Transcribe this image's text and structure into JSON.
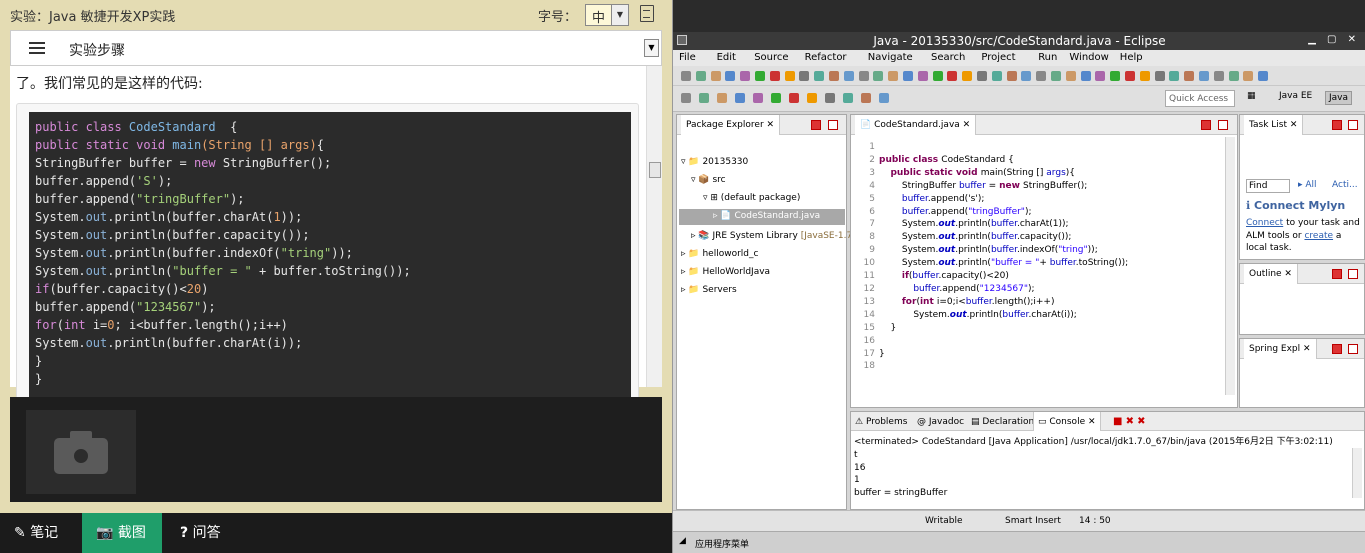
{
  "left": {
    "header_title": "实验：Java 敏捷开发XP实践",
    "font_label": "字号：",
    "font_value": "中",
    "steps_label": "实验步骤",
    "intro": "了。我们常见的是这样的代码:",
    "code_lines": [
      [
        [
          "kw",
          "public class "
        ],
        [
          "fn",
          "CodeStandard"
        ],
        [
          "",
          "  {"
        ]
      ],
      [
        [
          "kw",
          "public static void "
        ],
        [
          "fn",
          "main"
        ],
        [
          "nm",
          "(String [] args)"
        ],
        [
          "",
          "{"
        ]
      ],
      [
        [
          "",
          "StringBuffer buffer = "
        ],
        [
          "kw",
          "new "
        ],
        [
          "",
          "StringBuffer();"
        ]
      ],
      [
        [
          "",
          "buffer.append("
        ],
        [
          "st",
          "'S'"
        ],
        [
          "",
          ");"
        ]
      ],
      [
        [
          "",
          "buffer.append("
        ],
        [
          "st",
          "\"tringBuffer\""
        ],
        [
          "",
          ");"
        ]
      ],
      [
        [
          "",
          "System."
        ],
        [
          "ob",
          "out"
        ],
        [
          "",
          ".println(buffer.charAt("
        ],
        [
          "nm",
          "1"
        ],
        [
          "",
          "));"
        ]
      ],
      [
        [
          "",
          "System."
        ],
        [
          "ob",
          "out"
        ],
        [
          "",
          ".println(buffer.capacity());"
        ]
      ],
      [
        [
          "",
          "System."
        ],
        [
          "ob",
          "out"
        ],
        [
          "",
          ".println(buffer.indexOf("
        ],
        [
          "st",
          "\"tring\""
        ],
        [
          "",
          "));"
        ]
      ],
      [
        [
          "",
          "System."
        ],
        [
          "ob",
          "out"
        ],
        [
          "",
          ".println("
        ],
        [
          "st",
          "\"buffer = \""
        ],
        [
          "",
          " + buffer.toString());"
        ]
      ],
      [
        [
          "kw",
          "if"
        ],
        [
          "",
          "(buffer.capacity()<"
        ],
        [
          "nm",
          "20"
        ],
        [
          "",
          ")"
        ]
      ],
      [
        [
          "",
          "buffer.append("
        ],
        [
          "st",
          "\"1234567\""
        ],
        [
          "",
          ");"
        ]
      ],
      [
        [
          "kw",
          "for"
        ],
        [
          "",
          "("
        ],
        [
          "kw",
          "int "
        ],
        [
          "",
          "i="
        ],
        [
          "nm",
          "0"
        ],
        [
          "",
          "; i<buffer.length();i++)"
        ]
      ],
      [
        [
          "",
          "System."
        ],
        [
          "ob",
          "out"
        ],
        [
          "",
          ".println(buffer.charAt(i));"
        ]
      ],
      [
        [
          "",
          "}"
        ]
      ],
      [
        [
          "",
          "}"
        ]
      ]
    ],
    "bottom_tabs": [
      {
        "icon": "pencil-icon",
        "label": "笔记"
      },
      {
        "icon": "camera-icon",
        "label": "截图"
      },
      {
        "icon": "question-icon",
        "label": "问答"
      }
    ]
  },
  "eclipse": {
    "title": "Java - 20135330/src/CodeStandard.java - Eclipse",
    "menu": [
      "File",
      "Edit",
      "Source",
      "Refactor",
      "Navigate",
      "Search",
      "Project",
      "Run",
      "Window",
      "Help"
    ],
    "quick_access": "Quick Access",
    "perspectives": [
      "Java EE",
      "Java"
    ],
    "package_explorer": {
      "tab": "Package Explorer",
      "items": [
        "20135330",
        "src",
        "(default package)",
        "CodeStandard.java",
        "JRE System Library",
        "[JavaSE-1.7]",
        "helloworld_c",
        "HelloWorldJava",
        "Servers"
      ]
    },
    "editor": {
      "tab": "CodeStandard.java",
      "line_numbers": [
        "1",
        "2",
        "3",
        "4",
        "5",
        "6",
        "7",
        "8",
        "9",
        "10",
        "11",
        "12",
        "13",
        "14",
        "15",
        "16",
        "17",
        "18"
      ],
      "lines": [
        [],
        [
          [
            "ek",
            "public class "
          ],
          [
            "",
            "CodeStandard {"
          ]
        ],
        [
          [
            "",
            "    "
          ],
          [
            "ek",
            "public static void "
          ],
          [
            "",
            "main(String [] "
          ],
          [
            "ev",
            "args"
          ],
          [
            "",
            ")"
          ],
          [
            "",
            "{"
          ]
        ],
        [
          [
            "",
            "        StringBuffer "
          ],
          [
            "ev",
            "buffer"
          ],
          [
            "",
            " = "
          ],
          [
            "ek",
            "new "
          ],
          [
            "",
            "StringBuffer();"
          ]
        ],
        [
          [
            "",
            "        "
          ],
          [
            "ev",
            "buffer"
          ],
          [
            "",
            ".append('s');"
          ]
        ],
        [
          [
            "",
            "        "
          ],
          [
            "ev",
            "buffer"
          ],
          [
            "",
            ".append("
          ],
          [
            "es",
            "\"tringBuffer\""
          ],
          [
            "",
            ");"
          ]
        ],
        [
          [
            "",
            "        System."
          ],
          [
            "ei",
            "out"
          ],
          [
            "",
            ".println("
          ],
          [
            "ev",
            "buffer"
          ],
          [
            "",
            ".charAt(1));"
          ]
        ],
        [
          [
            "",
            "        System."
          ],
          [
            "ei",
            "out"
          ],
          [
            "",
            ".println("
          ],
          [
            "ev",
            "buffer"
          ],
          [
            "",
            ".capacity());"
          ]
        ],
        [
          [
            "",
            "        System."
          ],
          [
            "ei",
            "out"
          ],
          [
            "",
            ".println("
          ],
          [
            "ev",
            "buffer"
          ],
          [
            "",
            ".indexOf("
          ],
          [
            "es",
            "\"tring\""
          ],
          [
            "",
            "));"
          ]
        ],
        [
          [
            "",
            "        System."
          ],
          [
            "ei",
            "out"
          ],
          [
            "",
            ".println("
          ],
          [
            "es",
            "\"buffer = \""
          ],
          [
            "",
            "+ "
          ],
          [
            "ev",
            "buffer"
          ],
          [
            "",
            ".toString());"
          ]
        ],
        [
          [
            "",
            "        "
          ],
          [
            "ek",
            "if"
          ],
          [
            "",
            "("
          ],
          [
            "ev",
            "buffer"
          ],
          [
            "",
            ".capacity()<20)"
          ]
        ],
        [
          [
            "",
            "            "
          ],
          [
            "ev",
            "buffer"
          ],
          [
            "",
            ".append("
          ],
          [
            "es",
            "\"1234567\""
          ],
          [
            "",
            ");"
          ]
        ],
        [
          [
            "",
            "        "
          ],
          [
            "ek",
            "for"
          ],
          [
            "",
            "("
          ],
          [
            "ek",
            "int "
          ],
          [
            "",
            "i=0;i<"
          ],
          [
            "ev",
            "buffer"
          ],
          [
            "",
            ".length();i++)"
          ]
        ],
        [
          [
            "",
            "            System."
          ],
          [
            "ei",
            "out"
          ],
          [
            "",
            ".println("
          ],
          [
            "ev",
            "buffer"
          ],
          [
            "",
            ".charAt(i));"
          ]
        ],
        [
          [
            "",
            "    }"
          ]
        ],
        [],
        [
          [
            "",
            "}"
          ]
        ],
        []
      ]
    },
    "task_list": {
      "tab": "Task List",
      "find": "Find",
      "all": "All",
      "acti": "Acti..."
    },
    "mylyn": {
      "title": "Connect Mylyn",
      "text1": "Connect",
      "text2": " to your task and",
      "text3": "ALM tools or ",
      "text4": "create",
      "text5": " a",
      "text6": "local task."
    },
    "outline": {
      "tab": "Outline"
    },
    "spring": {
      "tab": "Spring Expl"
    },
    "bottom_tabs": [
      "Problems",
      "Javadoc",
      "Declaration",
      "Console"
    ],
    "console": {
      "header": "<terminated> CodeStandard [Java Application] /usr/local/jdk1.7.0_67/bin/java (2015年6月2日 下午3:02:11)",
      "lines": [
        "t",
        "16",
        "1",
        "buffer = stringBuffer"
      ]
    },
    "status": {
      "writable": "Writable",
      "insert": "Smart Insert",
      "pos": "14 : 50"
    },
    "taskbar": "应用程序菜单"
  }
}
